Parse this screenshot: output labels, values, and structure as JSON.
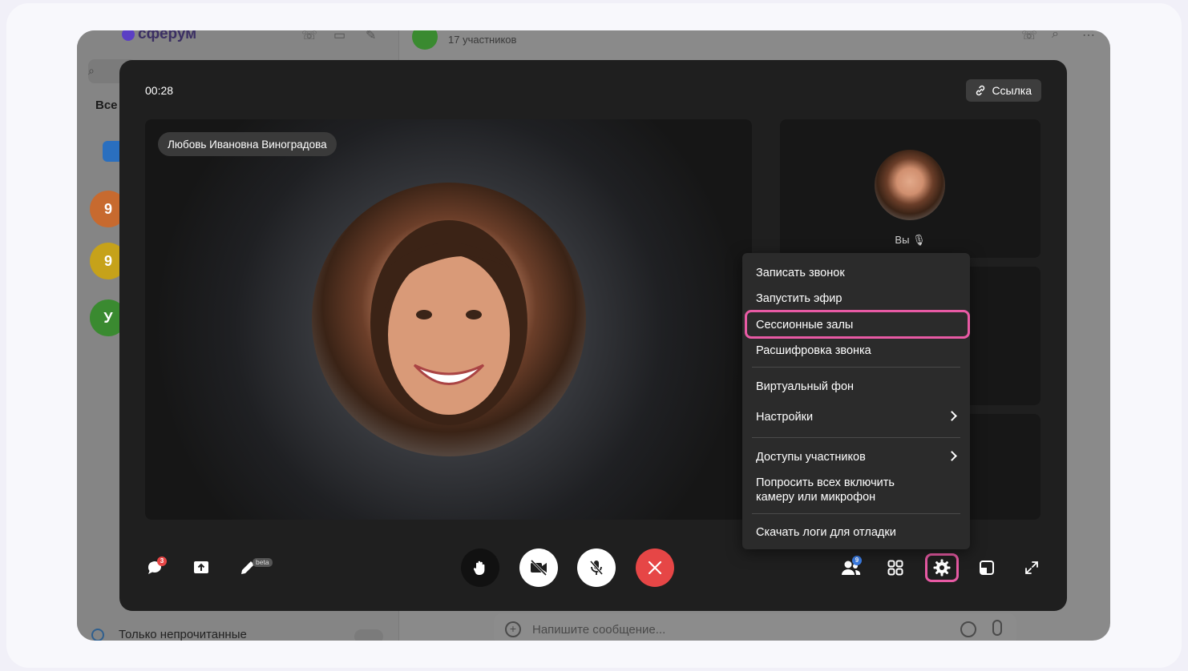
{
  "background_app": {
    "logo": "сферум",
    "tab_all": "Все",
    "chat_subtitle": "17 участников",
    "avatars": [
      {
        "letter": "9",
        "color": "#c76a2f"
      },
      {
        "letter": "9",
        "color": "#c6a21a"
      },
      {
        "letter": "У",
        "color": "#3a8a30"
      }
    ],
    "only_unread": "Только непрочитанные",
    "message_placeholder": "Напишите сообщение..."
  },
  "call": {
    "timer": "00:28",
    "link_button": "Ссылка",
    "speaker_name": "Любовь Ивановна Виноградова",
    "self_label": "Вы"
  },
  "menu": {
    "items": [
      {
        "label": "Записать звонок"
      },
      {
        "label": "Запустить эфир"
      },
      {
        "label": "Сессионные залы",
        "highlighted": true
      },
      {
        "label": "Расшифровка звонка"
      },
      {
        "label": "Виртуальный фон"
      },
      {
        "label": "Настройки",
        "submenu": true
      },
      {
        "label": "Доступы участников",
        "submenu": true
      },
      {
        "label": "Попросить всех включить камеру или микрофон"
      },
      {
        "label": "Скачать логи для отладки"
      }
    ]
  },
  "controls": {
    "chat_badge": "3",
    "draw_badge": "beta",
    "participants_badge": "9",
    "end_call_color": "#e64646",
    "highlight_color": "#e85aa4"
  }
}
